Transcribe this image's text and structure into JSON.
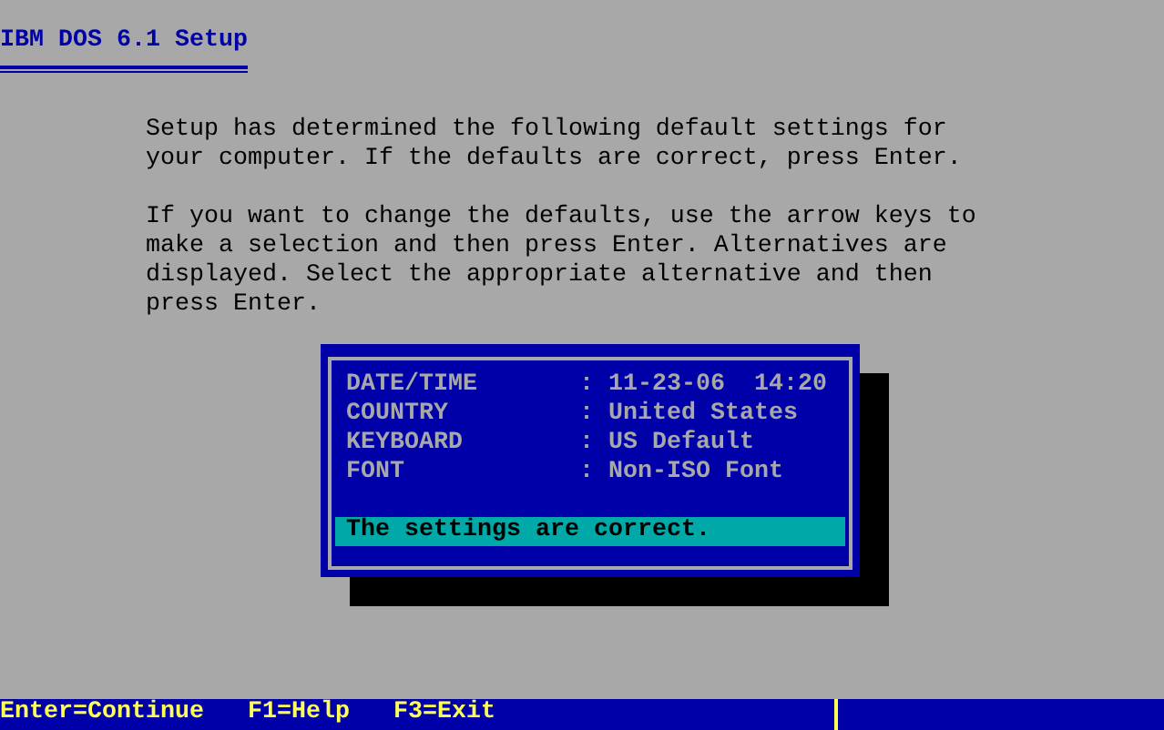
{
  "title": "IBM DOS 6.1 Setup",
  "paragraphs": [
    "Setup has determined the following default settings for your computer. If the defaults are correct, press Enter.",
    "If you want to change the defaults, use the arrow keys to make a selection and then press Enter. Alternatives are displayed. Select the appropriate alternative and then press Enter."
  ],
  "settings": [
    {
      "label": "DATE/TIME",
      "separator": ":",
      "value": "11-23-06  14:20"
    },
    {
      "label": "COUNTRY",
      "separator": ":",
      "value": "United States"
    },
    {
      "label": "KEYBOARD",
      "separator": ":",
      "value": "US Default"
    },
    {
      "label": "FONT",
      "separator": ":",
      "value": "Non-ISO Font"
    }
  ],
  "options": [
    {
      "label": "The settings are correct.",
      "selected": true
    }
  ],
  "status_bar": [
    "Enter=Continue",
    "F1=Help",
    "F3=Exit"
  ]
}
